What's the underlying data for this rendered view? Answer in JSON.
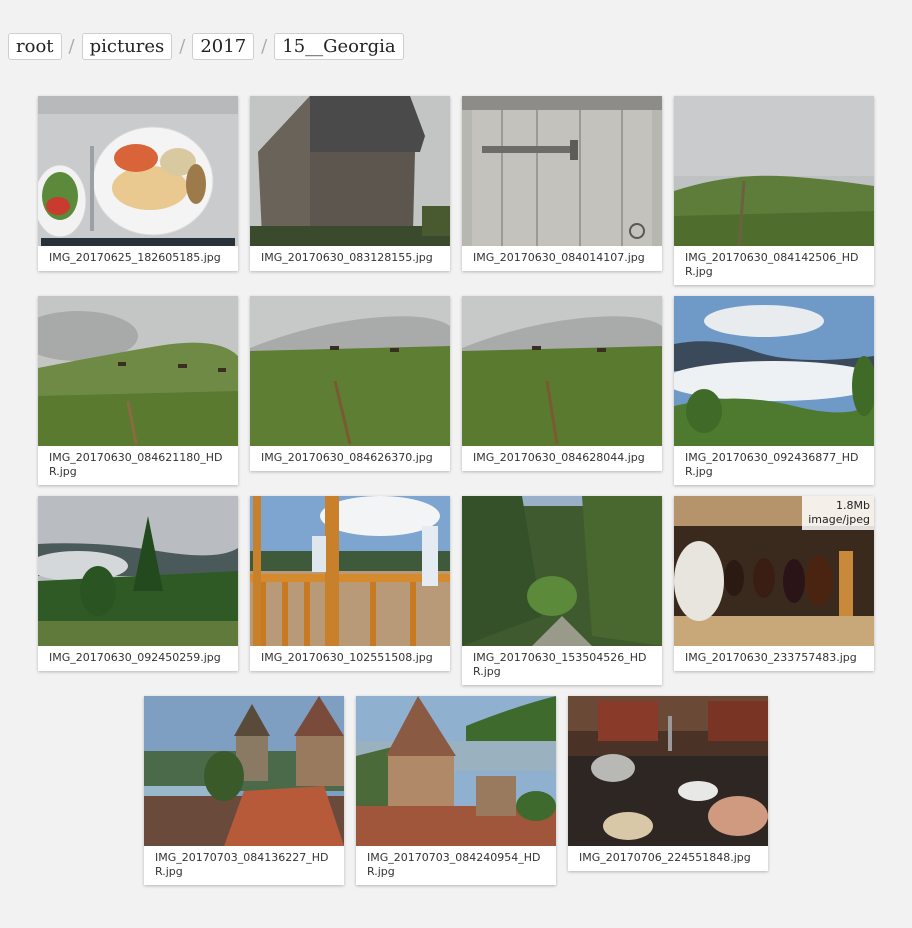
{
  "breadcrumb": {
    "items": [
      "root",
      "pictures",
      "2017",
      "15__Georgia"
    ],
    "separator": "/"
  },
  "gallery": {
    "rows": [
      [
        {
          "name": "IMG_20170625_182605185.jpg",
          "subject": "plate-of-food"
        },
        {
          "name": "IMG_20170630_083128155.jpg",
          "subject": "stone-hut"
        },
        {
          "name": "IMG_20170630_084014107.jpg",
          "subject": "wooden-door"
        },
        {
          "name": "IMG_20170630_084142506_HDR.jpg",
          "subject": "foggy-hill"
        }
      ],
      [
        {
          "name": "IMG_20170630_084621180_HDR.jpg",
          "subject": "foggy-pasture-cows"
        },
        {
          "name": "IMG_20170630_084626370.jpg",
          "subject": "foggy-pasture-cows"
        },
        {
          "name": "IMG_20170630_084628044.jpg",
          "subject": "foggy-pasture-cows"
        },
        {
          "name": "IMG_20170630_092436877_HDR.jpg",
          "subject": "mountain-clouds"
        }
      ],
      [
        {
          "name": "IMG_20170630_092450259.jpg",
          "subject": "mountain-forest"
        },
        {
          "name": "IMG_20170630_102551508.jpg",
          "subject": "porch-bottles"
        },
        {
          "name": "IMG_20170630_153504526_HDR.jpg",
          "subject": "forest-gorge"
        },
        {
          "name": "IMG_20170630_233757483.jpg",
          "subject": "cellar-jars",
          "info": {
            "size": "1.8Mb",
            "type": "image/jpeg"
          }
        }
      ],
      [
        {
          "name": "IMG_20170703_084136227_HDR.jpg",
          "subject": "fortress-towers"
        },
        {
          "name": "IMG_20170703_084240954_HDR.jpg",
          "subject": "fortress-church"
        },
        {
          "name": "IMG_20170706_224551848.jpg",
          "subject": "dinner-table"
        }
      ]
    ]
  }
}
